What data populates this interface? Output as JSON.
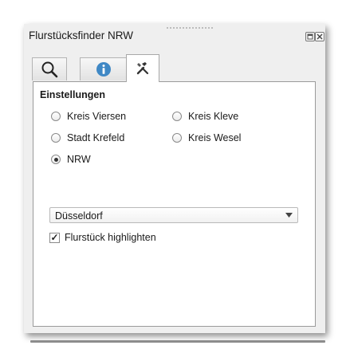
{
  "window": {
    "title": "Flurstücksfinder NRW"
  },
  "tabs": [
    {
      "icon": "search-icon",
      "active": false
    },
    {
      "icon": "info-icon",
      "active": false
    },
    {
      "icon": "tools-icon",
      "active": true
    }
  ],
  "settings": {
    "heading": "Einstellungen",
    "radios": [
      {
        "label": "Kreis Viersen",
        "checked": false
      },
      {
        "label": "Kreis Kleve",
        "checked": false
      },
      {
        "label": "Stadt Krefeld",
        "checked": false
      },
      {
        "label": "Kreis Wesel",
        "checked": false
      },
      {
        "label": "NRW",
        "checked": true
      }
    ],
    "combo_value": "Düsseldorf",
    "highlight": {
      "label": "Flurstück highlighten",
      "checked": true,
      "mark": "✓"
    }
  },
  "colors": {
    "info_icon": "#3f88c5",
    "border": "#9a9a9a"
  }
}
